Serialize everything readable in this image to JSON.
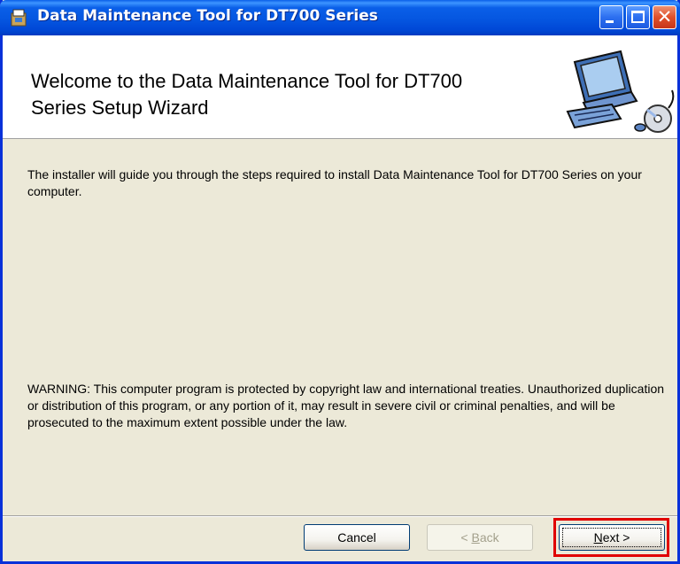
{
  "window": {
    "title": "Data Maintenance Tool for DT700 Series",
    "controls": [
      "minimize",
      "maximize",
      "close"
    ]
  },
  "banner": {
    "title_line1": "Welcome to the Data Maintenance Tool for DT700",
    "title_line2": "Series Setup Wizard",
    "art_icon": "computer-cd-icon"
  },
  "content": {
    "intro": "The installer will guide you through the steps required to install Data Maintenance Tool for DT700 Series on your computer.",
    "warning": "WARNING: This computer program is protected by copyright law and international treaties. Unauthorized duplication or distribution of this program, or any portion of it, may result in severe civil or criminal penalties, and will be prosecuted to the maximum extent possible under the law."
  },
  "buttons": {
    "cancel": "Cancel",
    "back_prefix": "< ",
    "back_accel": "B",
    "back_rest": "ack",
    "next_accel": "N",
    "next_rest": "ext >"
  },
  "colors": {
    "titlebar": "#0a5fe8",
    "dialog_bg": "#ece9d8",
    "highlight": "#e00000"
  }
}
